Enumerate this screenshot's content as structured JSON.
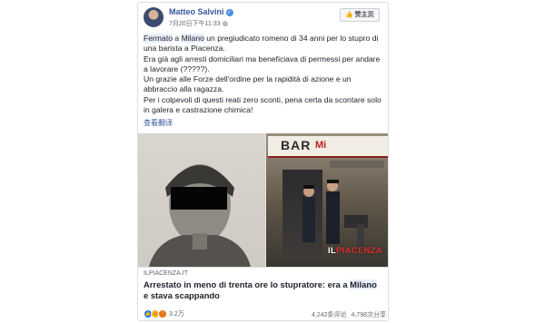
{
  "post": {
    "author": "Matteo Salvini",
    "timestamp": "7月20日下午11:33",
    "like_page_label": "赞主页",
    "text": {
      "p1_fermato": "Fermato",
      "p1_a": " a ",
      "p1_milano": "Milano",
      "p1_rest": " un pregiudicato romeno di 34 anni per lo stupro di una barista a Piacenza.",
      "p2": "Era già agli arresti domiciliari ma beneficiava di permessi per andare a lavorare (?????).",
      "p3": "Un grazie alle Forze dell'ordine per la rapidità di azione e un abbraccio alla ragazza.",
      "p4": "Per i colpevoli di questi reati zero sconti, pena certa da scontare solo in galera e castrazione chimica!"
    },
    "see_translation": "查看翻译"
  },
  "link_preview": {
    "sign_bar": "BAR",
    "sign_red": "Mi",
    "watermark_il": "IL",
    "watermark_name": "PIACENZA",
    "domain": "ILPIACENZA.IT",
    "headline_before": "Arrestato in meno di trenta ore lo stupratore: era a ",
    "headline_milano": "Milano",
    "headline_after": " e stava scappando"
  },
  "footer": {
    "reaction_count": "3.2万",
    "comments": "4,242条评论",
    "shares": "4,798次分享"
  },
  "icons": [
    "verified-badge-icon",
    "globe-icon",
    "like-thumb-icon",
    "reaction-like-icon",
    "reaction-haha-icon",
    "reaction-angry-icon"
  ],
  "colors": {
    "link_blue": "#385898",
    "text": "#1d2129",
    "meta_gray": "#606770",
    "border": "#dddfe2"
  }
}
